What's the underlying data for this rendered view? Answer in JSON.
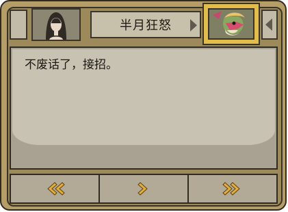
{
  "speaker": {
    "name": "半月狂怒"
  },
  "dialog": {
    "text": "不废话了，接招。"
  },
  "controls": {
    "rewind_icon": "double-chevron-left-icon",
    "next_icon": "chevron-right-icon",
    "fast_forward_icon": "double-chevron-right-icon"
  },
  "colors": {
    "accent_gold": "#e3bd4c",
    "arrow": "#e2ad3b",
    "frame": "#b49d67"
  }
}
